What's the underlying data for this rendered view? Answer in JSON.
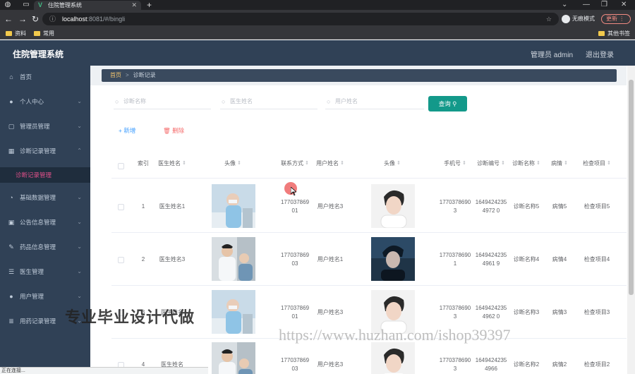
{
  "browser": {
    "tab_title": "住院管理系统",
    "url_host": "localhost",
    "url_path": ":8081/#/bingli",
    "incognito_label": "无痕模式",
    "update_label": "更新",
    "bookmarks": [
      "资料",
      "常用"
    ],
    "other_bookmarks": "其他书签"
  },
  "app": {
    "title": "住院管理系统",
    "admin_label": "管理员 admin",
    "logout_label": "退出登录"
  },
  "sidebar": {
    "items": [
      {
        "label": "首页",
        "icon": "home-icon"
      },
      {
        "label": "个人中心",
        "icon": "user-icon"
      },
      {
        "label": "管理员管理",
        "icon": "admin-icon"
      },
      {
        "label": "诊断记录管理",
        "icon": "grid-icon"
      },
      {
        "label": "基础数据管理",
        "icon": "gauge-icon"
      },
      {
        "label": "公告信息管理",
        "icon": "notice-icon"
      },
      {
        "label": "药品信息管理",
        "icon": "pill-icon"
      },
      {
        "label": "医生管理",
        "icon": "sliders-icon"
      },
      {
        "label": "用户管理",
        "icon": "user-icon"
      },
      {
        "label": "用药记录管理",
        "icon": "list-icon"
      }
    ],
    "active_sub": "诊断记录管理"
  },
  "breadcrumb": {
    "home": "首页",
    "sep": ">",
    "current": "诊断记录"
  },
  "search": {
    "diagnosis_placeholder": "诊断名称",
    "doctor_placeholder": "医生姓名",
    "user_placeholder": "用户姓名",
    "query_label": "查询"
  },
  "actions": {
    "add_label": "新增",
    "delete_label": "删除"
  },
  "table": {
    "headers": {
      "index": "索引",
      "doctor_name": "医生姓名",
      "doctor_avatar": "头像",
      "contact": "联系方式",
      "user_name": "用户姓名",
      "user_avatar": "头像",
      "phone": "手机号",
      "diag_no": "诊断编号",
      "diag_name": "诊断名称",
      "condition": "病情",
      "exam": "检查项目"
    },
    "rows": [
      {
        "index": "1",
        "doctor_name": "医生姓名1",
        "contact": "17703786901",
        "user_name": "用户姓名3",
        "phone": "17703786903",
        "diag_no": "16494242354972 0",
        "diag_name": "诊断名称5",
        "condition": "病情5",
        "exam": "检查项目5"
      },
      {
        "index": "2",
        "doctor_name": "医生姓名3",
        "contact": "17703786903",
        "user_name": "用户姓名1",
        "phone": "17703786901",
        "diag_no": "16494242354961 9",
        "diag_name": "诊断名称4",
        "condition": "病情4",
        "exam": "检查项目4"
      },
      {
        "index": "3",
        "doctor_name": "医生姓名",
        "contact": "17703786901",
        "user_name": "用户姓名3",
        "phone": "17703786903",
        "diag_no": "16494242354962 0",
        "diag_name": "诊断名称3",
        "condition": "病情3",
        "exam": "检查项目3"
      },
      {
        "index": "4",
        "doctor_name": "医生姓名",
        "contact": "17703786903",
        "user_name": "用户姓名3",
        "phone": "17703786903",
        "diag_no": "16494242354966",
        "diag_name": "诊断名称2",
        "condition": "病情2",
        "exam": "检查项目2"
      }
    ]
  },
  "watermarks": {
    "text_cn": "专业毕业设计代做",
    "text_url": "https://www.huzhan.com/ishop39397"
  },
  "status_text": "正在连接..."
}
